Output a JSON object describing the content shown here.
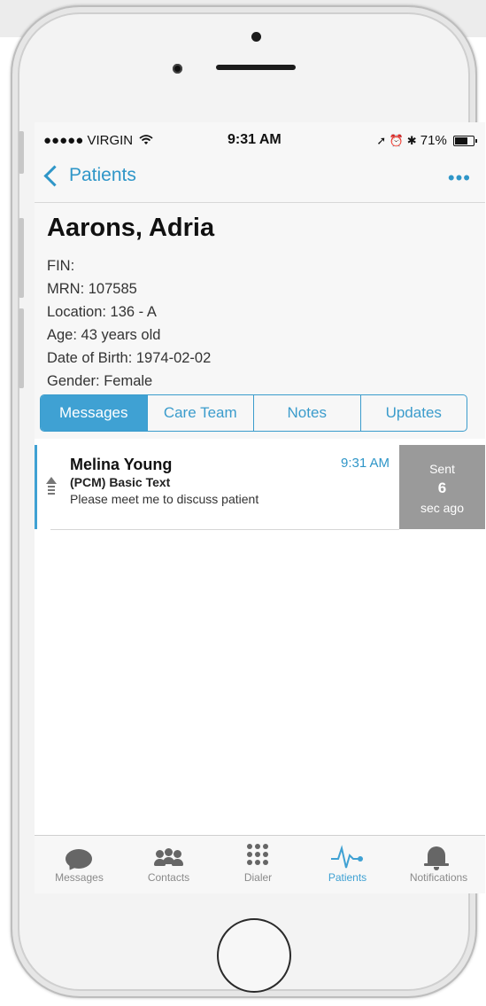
{
  "status_bar": {
    "carrier": "●●●●● VIRGIN",
    "wifi_icon": "wifi-icon",
    "time": "9:31 AM",
    "right_icons": "➚ ⏰ ✱",
    "battery_text": "71%",
    "battery_level": 0.71
  },
  "nav": {
    "back_label": "Patients",
    "more_label": "•••"
  },
  "patient": {
    "name": "Aarons, Adria",
    "fin": "FIN:",
    "mrn": "MRN: 107585",
    "location": "Location: 136 - A",
    "age": "Age: 43 years old",
    "dob": "Date of Birth: 1974-02-02",
    "gender": "Gender: Female"
  },
  "tabs_segment": [
    {
      "label": "Messages",
      "active": true
    },
    {
      "label": "Care Team",
      "active": false
    },
    {
      "label": "Notes",
      "active": false
    },
    {
      "label": "Updates",
      "active": false
    }
  ],
  "message": {
    "sender": "Melina Young",
    "subject": "(PCM) Basic Text",
    "body": "Please meet me to discuss patient",
    "time": "9:31 AM",
    "sent_label": "Sent",
    "sent_count": "6",
    "sent_ago": "sec ago"
  },
  "tabbar": [
    {
      "label": "Messages",
      "icon": "chat-bubble-icon",
      "active": false
    },
    {
      "label": "Contacts",
      "icon": "contacts-icon",
      "active": false
    },
    {
      "label": "Dialer",
      "icon": "dialer-grid-icon",
      "active": false
    },
    {
      "label": "Patients",
      "icon": "heartbeat-icon",
      "active": true
    },
    {
      "label": "Notifications",
      "icon": "bell-icon",
      "active": false
    }
  ],
  "colors": {
    "accent": "#3fa1d3",
    "sent_badge": "#9a9a9a"
  }
}
